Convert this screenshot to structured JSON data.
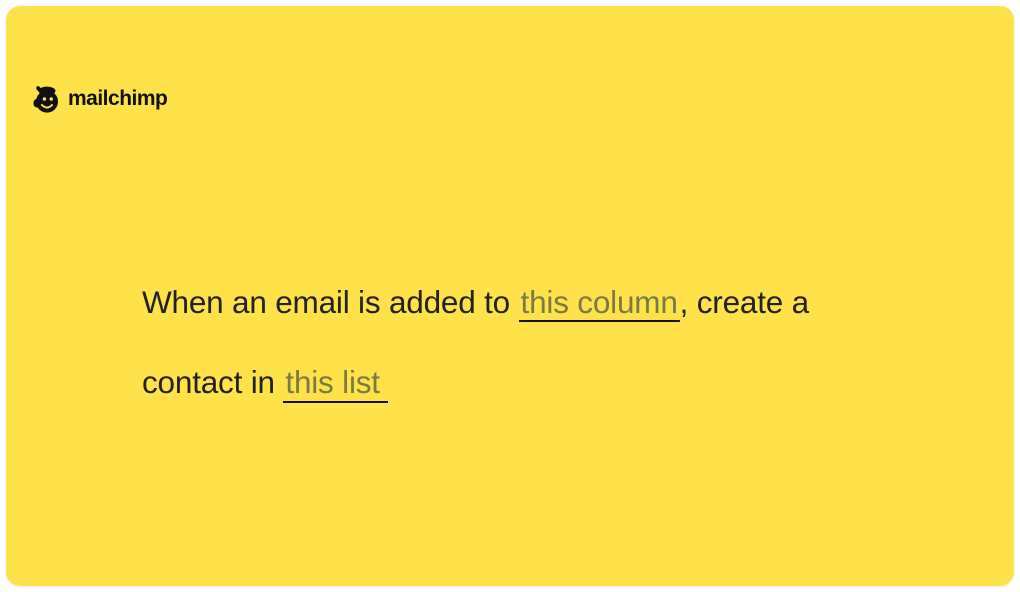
{
  "logo": {
    "text": "mailchimp",
    "icon_name": "mailchimp-freddie-icon"
  },
  "sentence": {
    "part1": "When an email is added to ",
    "slot1_placeholder": "this column",
    "part2": ", create a contact in ",
    "slot2_placeholder": "this list"
  },
  "colors": {
    "card_background": "#FFE14A",
    "text": "#222222",
    "placeholder": "#7a7a44",
    "underline": "#111111"
  }
}
